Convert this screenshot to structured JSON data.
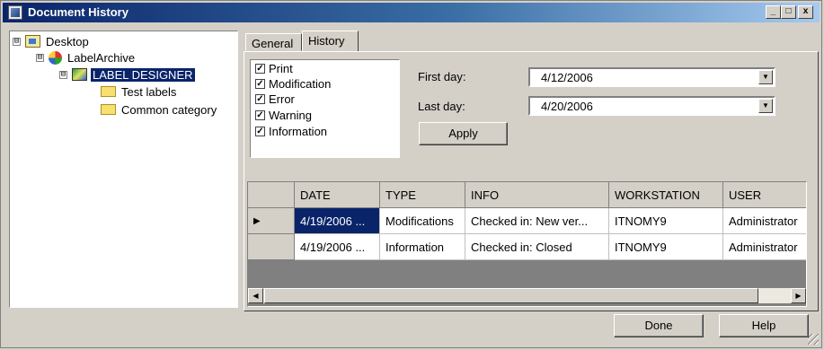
{
  "window": {
    "title": "Document History",
    "controls": {
      "minimize": "_",
      "maximize": "□",
      "close": "x"
    }
  },
  "tree": {
    "items": [
      {
        "label": "Desktop",
        "toggle": "⊟",
        "icon": "desktop-icon"
      },
      {
        "label": "LabelArchive",
        "toggle": "⊟",
        "icon": "archive-icon"
      },
      {
        "label": "LABEL DESIGNER",
        "toggle": "⊟",
        "icon": "designer-icon",
        "selected": true
      },
      {
        "label": "Test labels",
        "icon": "folder-icon"
      },
      {
        "label": "Common category",
        "icon": "folder-icon"
      }
    ]
  },
  "tabs": [
    {
      "label": "General",
      "active": false
    },
    {
      "label": "History",
      "active": true
    }
  ],
  "filters": [
    {
      "label": "Print",
      "checked": true,
      "mark": "✓"
    },
    {
      "label": "Modification",
      "checked": true,
      "mark": "✓"
    },
    {
      "label": "Error",
      "checked": true,
      "mark": "✓"
    },
    {
      "label": "Warning",
      "checked": true,
      "mark": "✓"
    },
    {
      "label": "Information",
      "checked": true,
      "mark": "✓"
    }
  ],
  "date_range": {
    "first_day_label": "First day:",
    "first_day_value": "4/12/2006",
    "last_day_label": "Last day:",
    "last_day_value": "4/20/2006",
    "dropdown_glyph": "▼"
  },
  "apply_label": "Apply",
  "table": {
    "columns": [
      "DATE",
      "TYPE",
      "INFO",
      "WORKSTATION",
      "USER"
    ],
    "current_row_marker": "▶",
    "rows": [
      [
        "4/19/2006 ...",
        "Modifications",
        "Checked in: New ver...",
        "ITNOMY9",
        "Administrator"
      ],
      [
        "4/19/2006 ...",
        "Information",
        "Checked in: Closed",
        "ITNOMY9",
        "Administrator"
      ]
    ],
    "scroll_left_glyph": "◀",
    "scroll_right_glyph": "▶"
  },
  "footer": {
    "done_label": "Done",
    "help_label": "Help"
  }
}
